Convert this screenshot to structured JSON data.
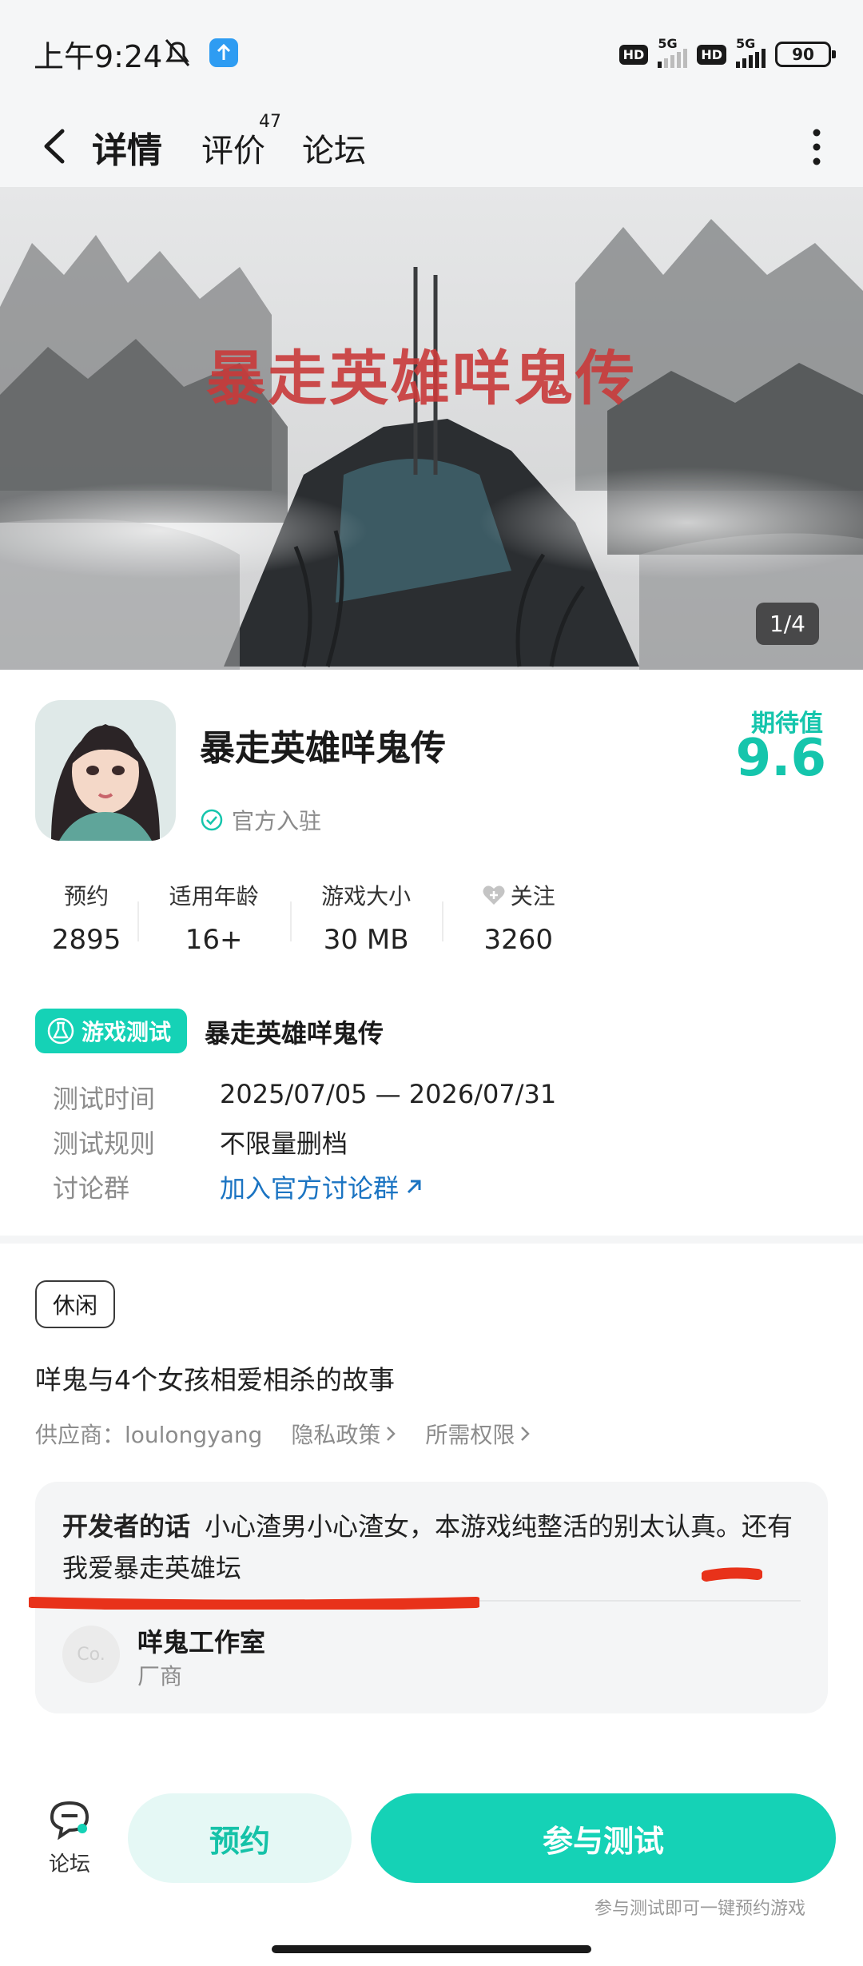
{
  "status": {
    "time": "上午9:24",
    "hd1": "HD",
    "net1": "5G",
    "hd2": "HD",
    "net2": "5G",
    "battery": "90"
  },
  "nav": {
    "tabs": [
      {
        "label": "详情",
        "active": true
      },
      {
        "label": "评价",
        "badge": "47"
      },
      {
        "label": "论坛"
      }
    ]
  },
  "banner": {
    "title": "暴走英雄咩鬼传",
    "page_indicator": "1/4"
  },
  "app": {
    "name": "暴走英雄咩鬼传",
    "official_label": "官方入驻",
    "expect_label": "期待值",
    "expect_value": "9.6"
  },
  "stats": [
    {
      "label": "预约",
      "value": "2895"
    },
    {
      "label": "适用年龄",
      "value": "16+"
    },
    {
      "label": "游戏大小",
      "value": "30 MB"
    },
    {
      "label": "关注",
      "value": "3260",
      "icon": "heart-icon"
    }
  ],
  "test": {
    "badge_label": "游戏测试",
    "name": "暴走英雄咩鬼传",
    "rows": [
      {
        "label": "测试时间",
        "value": "2025/07/05 — 2026/07/31"
      },
      {
        "label": "测试规则",
        "value": "不限量删档"
      },
      {
        "label": "讨论群",
        "value": "加入官方讨论群"
      }
    ]
  },
  "about": {
    "tag": "休闲",
    "description": "咩鬼与4个女孩相爱相杀的故事",
    "supplier": "供应商：loulongyang",
    "privacy": "隐私政策",
    "permissions": "所需权限"
  },
  "developer": {
    "label": "开发者的话",
    "message": "小心渣男小心渣女，本游戏纯整活的别太认真。还有我爱暴走英雄坛",
    "studio_avatar_text": "Co.",
    "studio_name": "咩鬼工作室",
    "studio_role": "厂商"
  },
  "bottom": {
    "forum_label": "论坛",
    "reserve_label": "预约",
    "join_label": "参与测试",
    "hint": "参与测试即可一键预约游戏"
  },
  "colors": {
    "accent": "#15d2b6",
    "link": "#1b74c2",
    "annotation": "#e8321a"
  }
}
